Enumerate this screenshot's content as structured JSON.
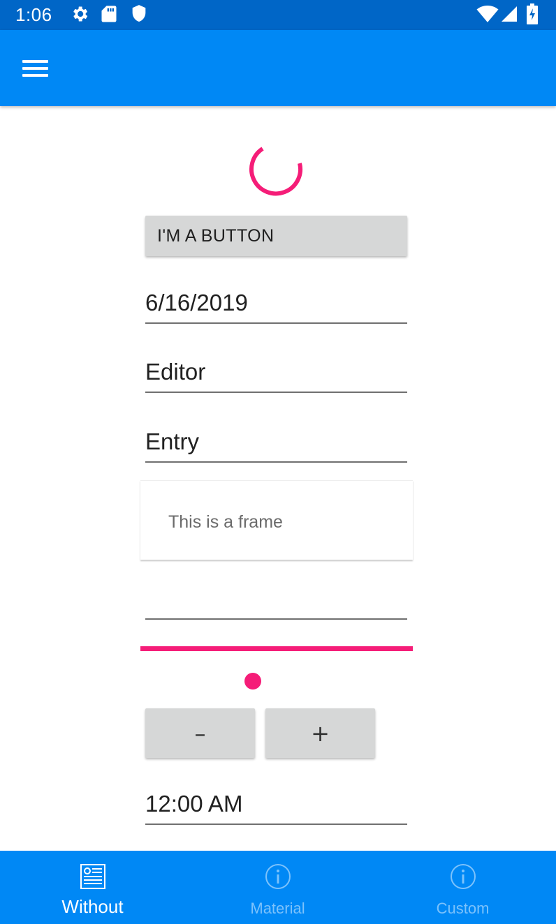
{
  "status_bar": {
    "time": "1:06",
    "left_icons": [
      "gear-icon",
      "sd-card-icon",
      "shield-icon"
    ],
    "right_icons": [
      "wifi-icon",
      "cell-signal-icon",
      "battery-charging-icon"
    ]
  },
  "app_bar": {
    "menu_icon": "hamburger-menu-icon"
  },
  "content": {
    "spinner_color": "#f51d78",
    "button_label": "I'M A BUTTON",
    "date_value": "6/16/2019",
    "editor_value": "Editor",
    "entry_value": "Entry",
    "frame_text": "This is a frame",
    "empty_field_value": "",
    "progress": 1.0,
    "slider_value": 0.41,
    "stepper": {
      "minus_label": "–",
      "plus_label": "+"
    },
    "time_value": "12:00 AM"
  },
  "tabs": [
    {
      "label": "Without",
      "icon": "list-document-icon",
      "active": true
    },
    {
      "label": "Material",
      "icon": "info-circle-icon",
      "active": false
    },
    {
      "label": "Custom",
      "icon": "info-circle-icon",
      "active": false
    }
  ],
  "colors": {
    "status_bar": "#0066c7",
    "app_bar": "#0088f5",
    "accent": "#f51d78",
    "button_bg": "#d6d7d7",
    "tab_inactive": "#7cc2fb"
  }
}
